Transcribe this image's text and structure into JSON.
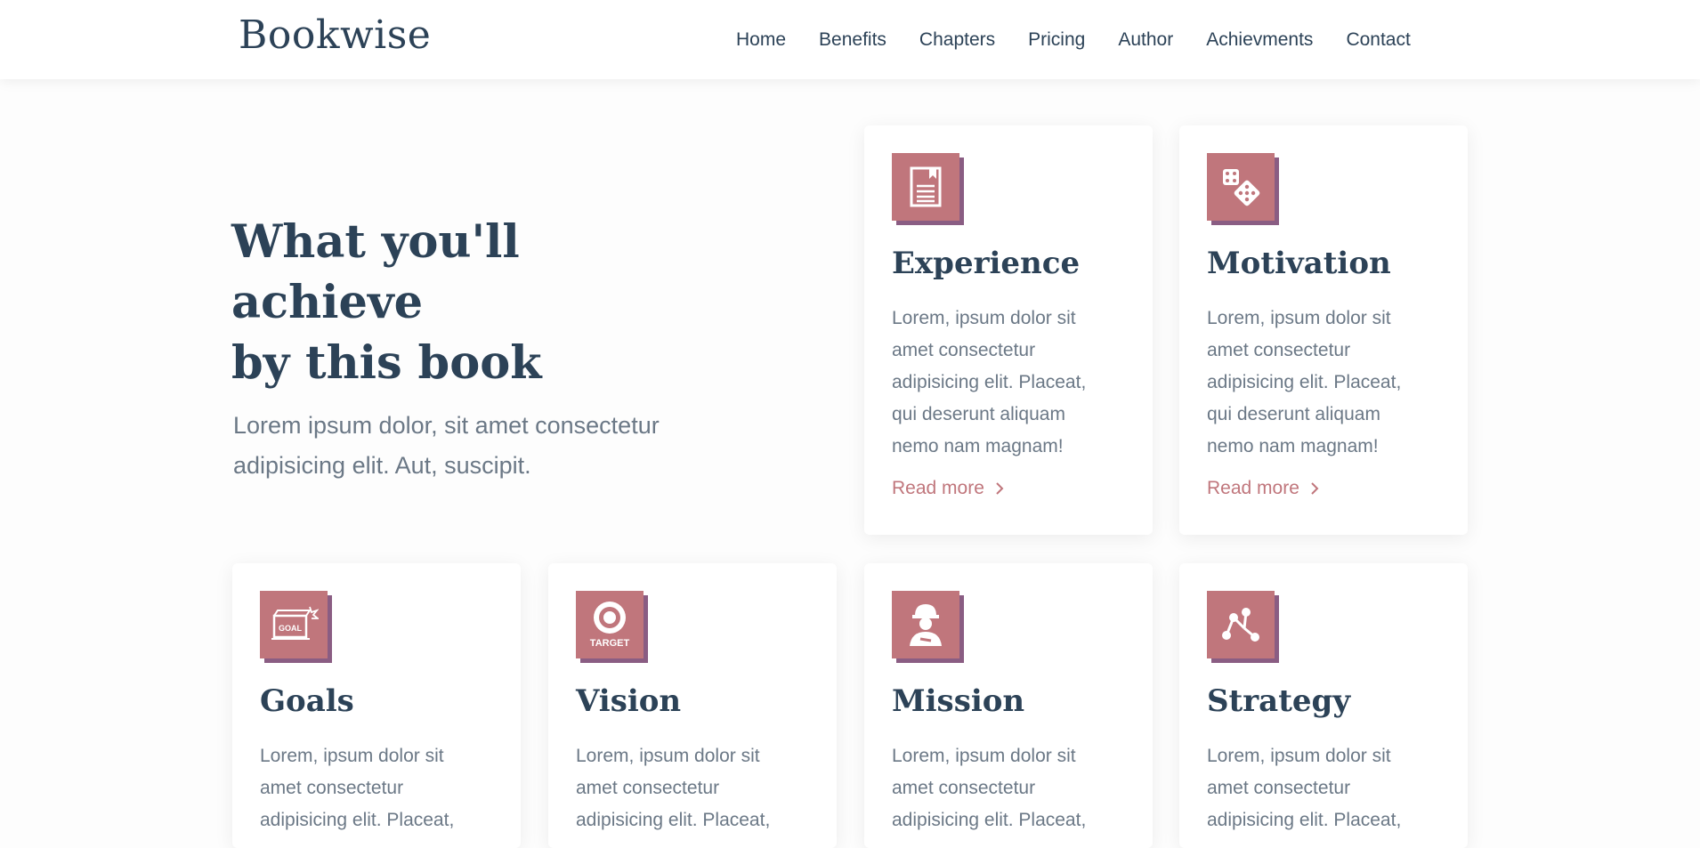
{
  "brand": "Bookwise",
  "nav": [
    "Home",
    "Benefits",
    "Chapters",
    "Pricing",
    "Author",
    "Achievments",
    "Contact"
  ],
  "hero": {
    "title_line1": "What you'll achieve",
    "title_line2": "by this book",
    "subtitle": "Lorem ipsum dolor, sit amet consectetur adipisicing elit. Aut, suscipit."
  },
  "cards": [
    {
      "icon": "document-icon",
      "title": "Experience",
      "text": "Lorem, ipsum dolor sit amet consectetur adipisicing elit. Placeat, qui deserunt aliquam nemo nam magnam!",
      "link": "Read more"
    },
    {
      "icon": "dice-icon",
      "title": "Motivation",
      "text": "Lorem, ipsum dolor sit amet consectetur adipisicing elit. Placeat, qui deserunt aliquam nemo nam magnam!",
      "link": "Read more"
    },
    {
      "icon": "goal-icon",
      "title": "Goals",
      "text": "Lorem, ipsum dolor sit amet consectetur adipisicing elit. Placeat,"
    },
    {
      "icon": "target-icon",
      "title": "Vision",
      "text": "Lorem, ipsum dolor sit amet consectetur adipisicing elit. Placeat,"
    },
    {
      "icon": "worker-icon",
      "title": "Mission",
      "text": "Lorem, ipsum dolor sit amet consectetur adipisicing elit. Placeat,"
    },
    {
      "icon": "nodes-icon",
      "title": "Strategy",
      "text": "Lorem, ipsum dolor sit amet consectetur adipisicing elit. Placeat,"
    }
  ],
  "icon_labels": {
    "goal": "GOAL",
    "target": "TARGET"
  },
  "colors": {
    "accent": "#c0767c",
    "accent_shadow": "#8a5d83",
    "heading": "#2c4257",
    "body_text": "#6b7886"
  }
}
